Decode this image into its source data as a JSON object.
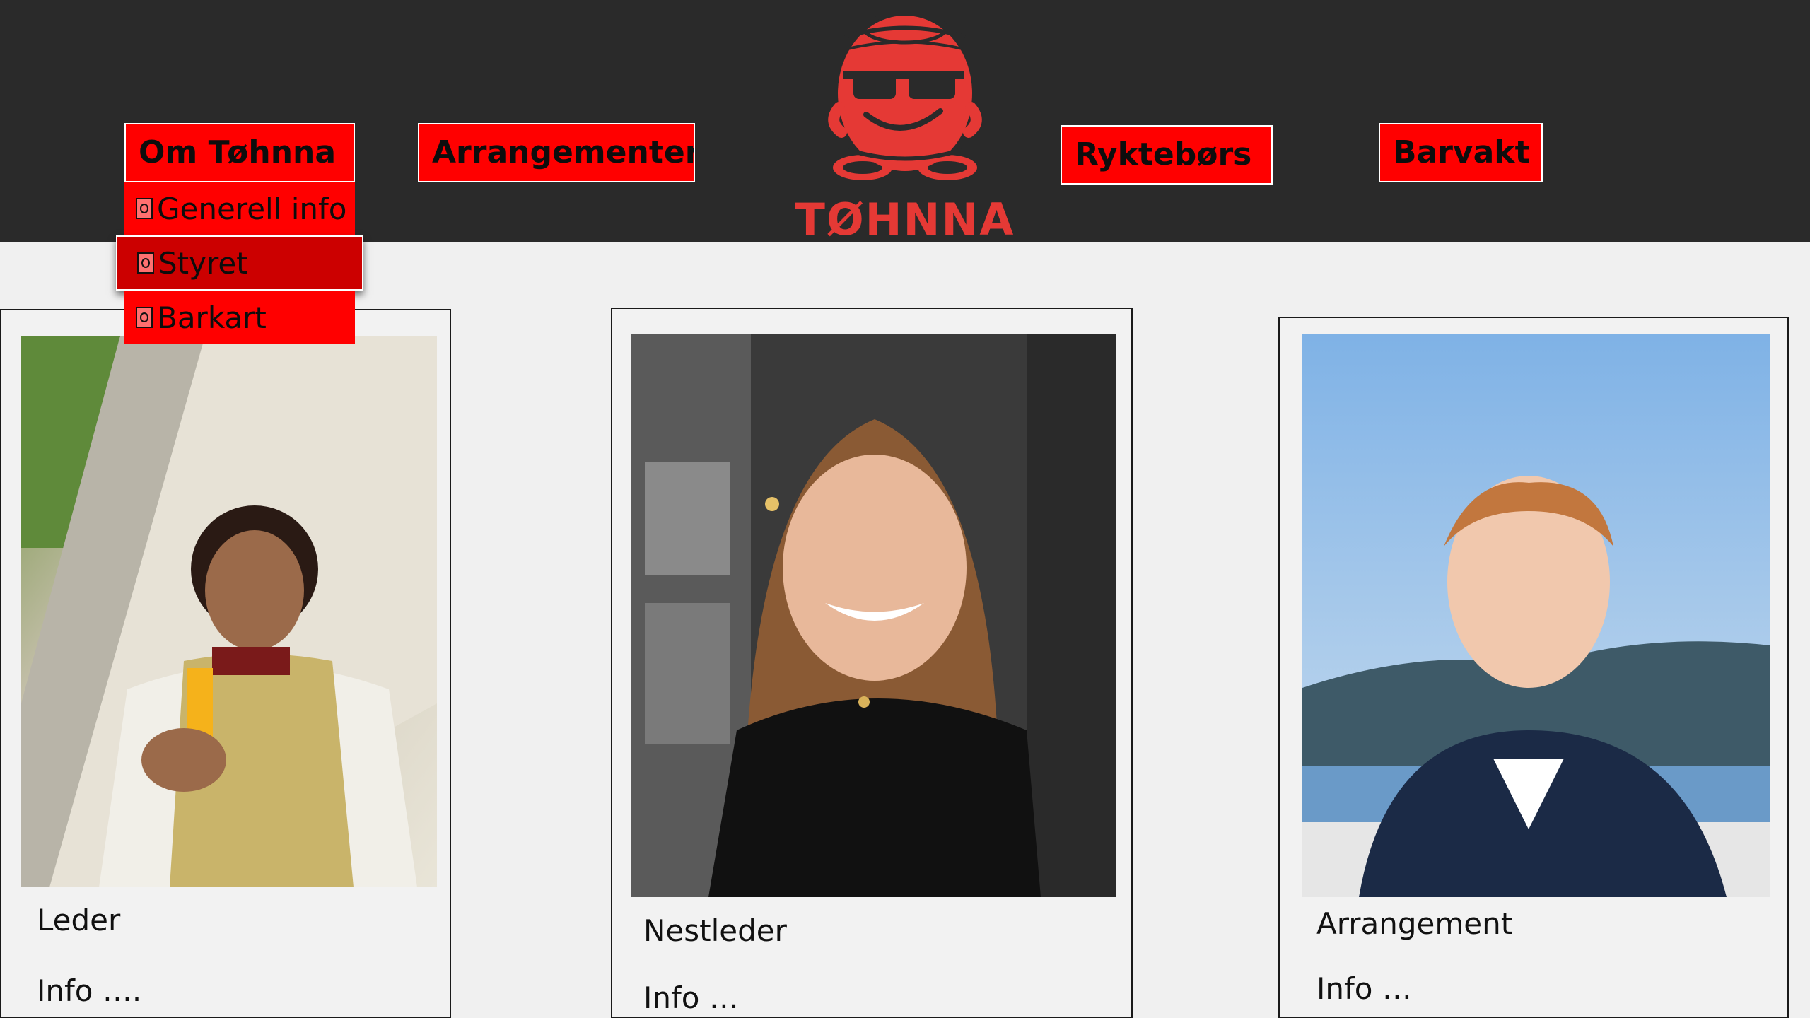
{
  "brand": {
    "name": "TØHNNA",
    "color": "#e53935"
  },
  "nav": {
    "om": "Om Tøhnna",
    "arrangementer": "Arrangementer",
    "ryktebors": "Ryktebørs",
    "barvakt": "Barvakt"
  },
  "dropdown": {
    "items": [
      {
        "label": "Generell info",
        "icon": "placeholder-glyph-icon"
      },
      {
        "label": "Styret",
        "icon": "placeholder-glyph-icon",
        "state": "hovered"
      },
      {
        "label": "Barkart",
        "icon": "placeholder-glyph-icon"
      }
    ]
  },
  "colors": {
    "header_bg": "#2a2a2a",
    "accent": "#ff0000",
    "page_bg": "#f0f0f0"
  },
  "board": {
    "members": [
      {
        "role": "Leder",
        "info": "Info …."
      },
      {
        "role": "Nestleder",
        "info": "Info …"
      },
      {
        "role": "Arrangement",
        "info": "Info …"
      }
    ]
  }
}
